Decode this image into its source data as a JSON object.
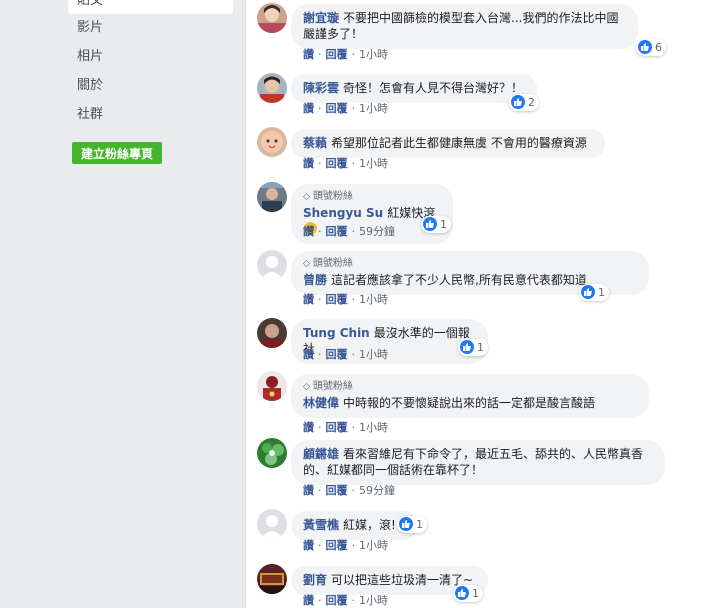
{
  "sidebar": {
    "items": [
      {
        "label": "貼文"
      },
      {
        "label": "影片"
      },
      {
        "label": "相片"
      },
      {
        "label": "關於"
      },
      {
        "label": "社群"
      }
    ],
    "create_button": "建立粉絲專頁"
  },
  "actions": {
    "like": "讚",
    "reply": "回覆",
    "separator": "·"
  },
  "badge_label": "頭號粉絲",
  "colors": {
    "link": "#385898",
    "bubble": "#f2f3f5",
    "like": "#2078f4",
    "create_button": "#42b72a"
  },
  "comments": [
    {
      "author": "謝宜璇",
      "text": "不要把中國篩檢的模型套入台灣...我們的作法比中國嚴謹多了！",
      "time": "1小時",
      "reactions": "6",
      "avatar": "avatar-photo",
      "badge": false
    },
    {
      "author": "陳彩雲",
      "text": "奇怪！怎會有人見不得台灣好？！",
      "time": "1小時",
      "reactions": "2",
      "avatar": "avatar-photo",
      "badge": false
    },
    {
      "author": "蔡藾",
      "text": "希望那位記者此生都健康無虞 不會用的醫療資源",
      "time": "1小時",
      "reactions": "",
      "avatar": "avatar-photo",
      "badge": false
    },
    {
      "author": "Shengyu Su",
      "text": "紅媒快滾",
      "time": "59分鐘",
      "reactions": "1",
      "avatar": "avatar-photo",
      "badge": true,
      "emoji": "angry-emoji"
    },
    {
      "author": "曾勝",
      "text": "這記者應該拿了不少人民幣,所有民意代表都知道",
      "time": "1小時",
      "reactions": "1",
      "avatar": "default-avatar",
      "badge": true
    },
    {
      "author": "Tung Chin",
      "text": "最沒水準的一個報社",
      "time": "1小時",
      "reactions": "1",
      "avatar": "avatar-photo",
      "badge": false
    },
    {
      "author": "林健偉",
      "text": "中時報的不要懷疑說出來的話一定都是酸言酸語",
      "time": "1小時",
      "reactions": "",
      "avatar": "avatar-photo",
      "badge": true
    },
    {
      "author": "顧鏘雄",
      "text": "看來習維尼有下命令了，最近五毛、舔共的、人民幣真香的、紅媒都同一個話術在靠杯了！",
      "time": "59分鐘",
      "reactions": "",
      "avatar": "avatar-photo",
      "badge": false
    },
    {
      "author": "黃雪樵",
      "text": "紅媒，滾!",
      "time": "1小時",
      "reactions": "1",
      "avatar": "default-avatar",
      "badge": false
    },
    {
      "author": "劉育",
      "text": "可以把這些垃圾清一清了~",
      "time": "1小時",
      "reactions": "1",
      "avatar": "avatar-photo",
      "badge": false
    }
  ]
}
